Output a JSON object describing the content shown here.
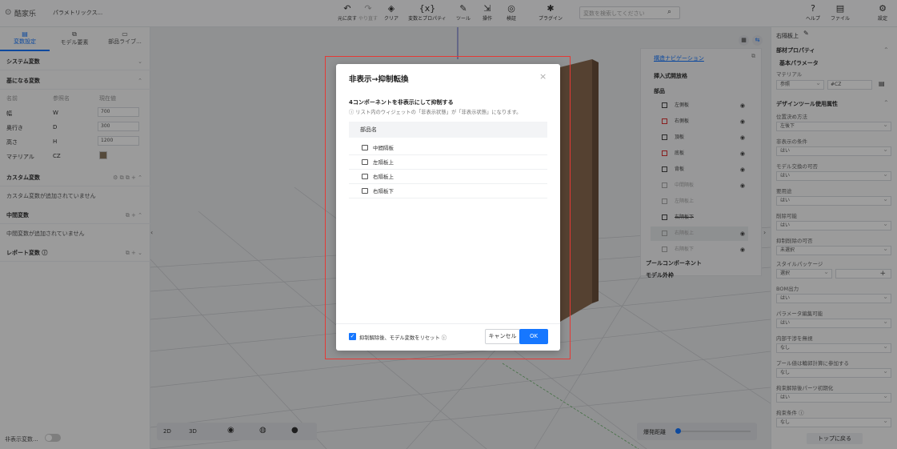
{
  "topbar": {
    "logo": "酷家乐",
    "title": "パラメトリックス...",
    "tools": [
      {
        "icon": "↶",
        "label": "元に戻す"
      },
      {
        "icon": "↷",
        "label": "やり直す"
      },
      {
        "icon": "◈",
        "label": "クリア"
      },
      {
        "icon": "{x}",
        "label": "変数とプロパティ"
      },
      {
        "icon": "✎",
        "label": "ツール"
      },
      {
        "icon": "⇲",
        "label": "操作"
      },
      {
        "icon": "◎",
        "label": "検証"
      },
      {
        "icon": "✱",
        "label": "プラグイン"
      }
    ],
    "search_placeholder": "変数を検索してください",
    "right": [
      {
        "icon": "?",
        "label": "ヘルプ"
      },
      {
        "icon": "▤",
        "label": "ファイル"
      },
      {
        "icon": "⚙",
        "label": "設定"
      }
    ]
  },
  "left": {
    "tabs": [
      "変数設定",
      "モデル要素",
      "部品ライブ..."
    ],
    "system_vars": "システム変数",
    "base_vars": "基になる変数",
    "var_cols": [
      "名前",
      "参照名",
      "現在値"
    ],
    "vars": [
      {
        "name": "幅",
        "ref": "W",
        "val": "700"
      },
      {
        "name": "奥行き",
        "ref": "D",
        "val": "300"
      },
      {
        "name": "高さ",
        "ref": "H",
        "val": "1200"
      },
      {
        "name": "マテリアル",
        "ref": "CZ",
        "val": ""
      }
    ],
    "custom_vars": "カスタム変数",
    "custom_empty": "カスタム変数が追加されていません",
    "mid_vars": "中間変数",
    "mid_empty": "中間変数が追加されていません",
    "report_vars": "レポート変数 ⓘ",
    "hidden_toggle": "非表示変数..."
  },
  "viewport": {
    "bottom": [
      "2D",
      "3D"
    ],
    "explode_label": "爆発距離"
  },
  "navpanel": {
    "title": "構造ナビゲーション",
    "inserted": "挿入式開放格",
    "parts": "部品",
    "items": [
      "左側板",
      "右側板",
      "頂板",
      "底板",
      "背板",
      "中間隔板",
      "左隔板上",
      "右隔板下",
      "右隔板上",
      "右隔板下"
    ],
    "pool": "プールコンポーネント",
    "model_outer": "モデル外枠"
  },
  "right": {
    "breadcrumb": "右隔板上",
    "prop_title": "部材プロパティ",
    "basic_params": "基本パラメータ",
    "material_label": "マテリアル",
    "material_ref": "参照",
    "material_val": "#CZ",
    "design_title": "デザインツール使用属性",
    "props": [
      {
        "label": "位置決め方法",
        "val": "左後下"
      },
      {
        "label": "非表示の条件",
        "val": "はい"
      },
      {
        "label": "モデル交換の可否",
        "val": "はい"
      },
      {
        "label": "要用途",
        "val": "はい"
      },
      {
        "label": "削除可能",
        "val": "はい"
      },
      {
        "label": "抑制削除の可否",
        "val": "未選択"
      },
      {
        "label": "スタイルパッケージ",
        "val": "選択"
      },
      {
        "label": "BOM出力",
        "val": "はい"
      },
      {
        "label": "パラメータ編集可能",
        "val": "はい"
      },
      {
        "label": "内部干渉を無視",
        "val": "なし"
      },
      {
        "label": "プール値は輪郭計算に参加する",
        "val": "なし"
      },
      {
        "label": "拘束解除後パーツ初期化",
        "val": "はい"
      },
      {
        "label": "拘束条件 ⓘ",
        "val": "なし"
      }
    ],
    "back_top": "トップに戻る"
  },
  "dialog": {
    "title": "非表示→抑制転換",
    "close": "×",
    "heading": "4コンポーネントを非表示にして抑制する",
    "info": "ⓘ リスト内のウィジェットの「非表示状態」が「非表示状態」になります。",
    "col": "部品名",
    "items": [
      "中間隔板",
      "左隔板上",
      "右隔板上",
      "右隔板下"
    ],
    "checkbox_label": "抑制解除後、モデル変数をリセット ⓘ",
    "cancel": "キャンセル",
    "ok": "OK"
  }
}
